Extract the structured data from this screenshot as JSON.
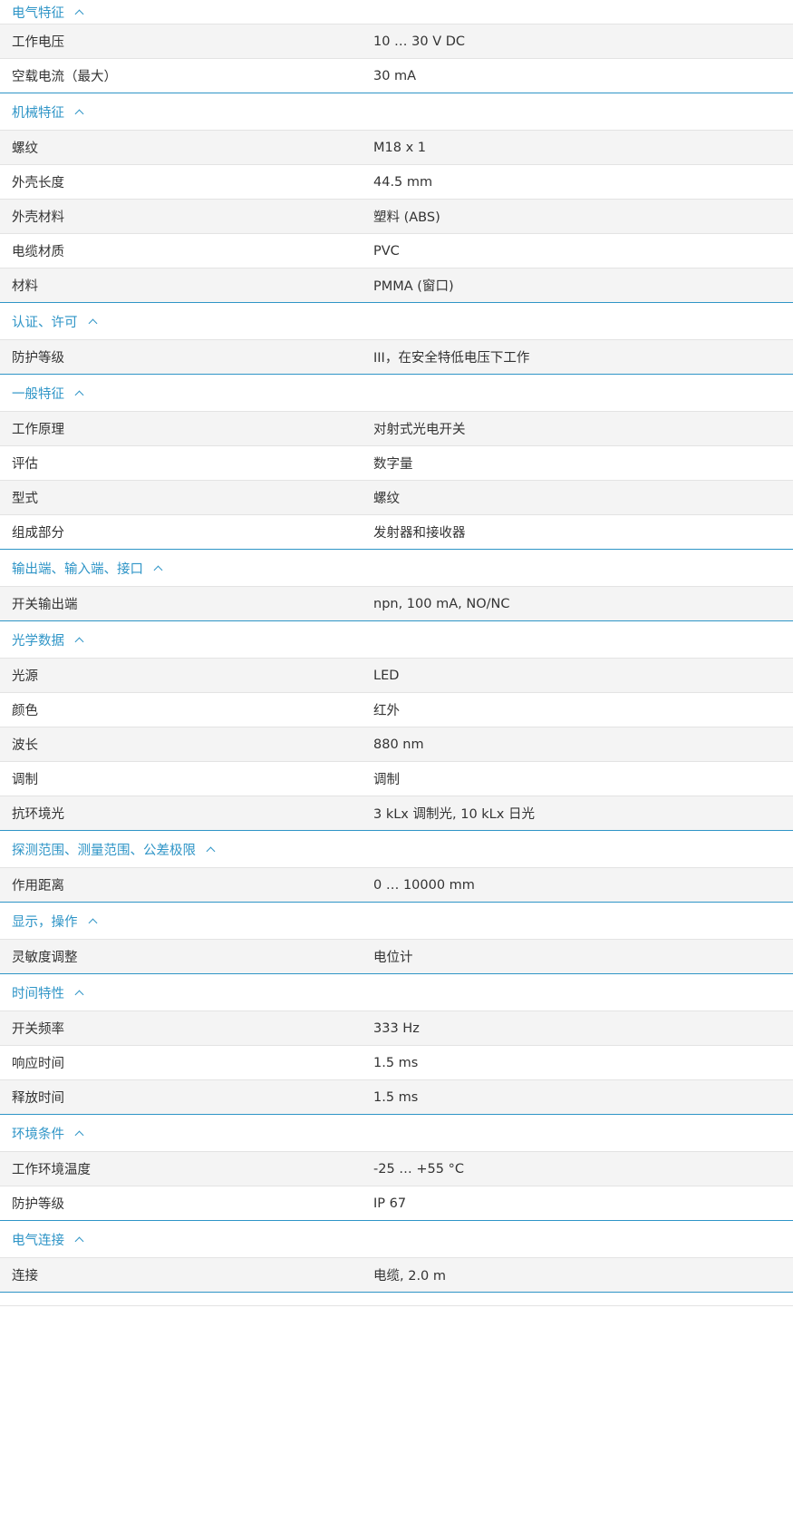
{
  "sections": [
    {
      "title": "电气特征",
      "rows": [
        {
          "label": "工作电压",
          "value": "10 … 30 V DC"
        },
        {
          "label": "空载电流（最大）",
          "value": "30 mA"
        }
      ]
    },
    {
      "title": "机械特征",
      "rows": [
        {
          "label": "螺纹",
          "value": "M18 x 1"
        },
        {
          "label": "外壳长度",
          "value": "44.5 mm"
        },
        {
          "label": "外壳材料",
          "value": "塑料 (ABS)"
        },
        {
          "label": "电缆材质",
          "value": "PVC"
        },
        {
          "label": "材料",
          "value": "PMMA (窗口)"
        }
      ]
    },
    {
      "title": "认证、许可",
      "rows": [
        {
          "label": "防护等级",
          "value": "III，在安全特低电压下工作"
        }
      ]
    },
    {
      "title": "一般特征",
      "rows": [
        {
          "label": "工作原理",
          "value": "对射式光电开关"
        },
        {
          "label": "评估",
          "value": "数字量"
        },
        {
          "label": "型式",
          "value": "螺纹"
        },
        {
          "label": "组成部分",
          "value": "发射器和接收器"
        }
      ]
    },
    {
      "title": "输出端、输入端、接口",
      "rows": [
        {
          "label": "开关输出端",
          "value": "npn, 100 mA, NO/NC"
        }
      ]
    },
    {
      "title": "光学数据",
      "rows": [
        {
          "label": "光源",
          "value": "LED"
        },
        {
          "label": "颜色",
          "value": "红外"
        },
        {
          "label": "波长",
          "value": "880 nm"
        },
        {
          "label": "调制",
          "value": "调制"
        },
        {
          "label": "抗环境光",
          "value": "3 kLx 调制光, 10 kLx 日光"
        }
      ]
    },
    {
      "title": "探测范围、测量范围、公差极限",
      "rows": [
        {
          "label": "作用距离",
          "value": "0 … 10000 mm"
        }
      ]
    },
    {
      "title": "显示，操作",
      "rows": [
        {
          "label": "灵敏度调整",
          "value": "电位计"
        }
      ]
    },
    {
      "title": "时间特性",
      "rows": [
        {
          "label": "开关频率",
          "value": "333 Hz"
        },
        {
          "label": "响应时间",
          "value": "1.5 ms"
        },
        {
          "label": "释放时间",
          "value": "1.5 ms"
        }
      ]
    },
    {
      "title": "环境条件",
      "rows": [
        {
          "label": "工作环境温度",
          "value": "-25 … +55 °C"
        },
        {
          "label": "防护等级",
          "value": "IP 67"
        }
      ]
    },
    {
      "title": "电气连接",
      "rows": [
        {
          "label": "连接",
          "value": "电缆, 2.0 m"
        }
      ]
    }
  ],
  "colors": {
    "accent": "#2f95c7",
    "row_alt": "#f4f4f4",
    "divider": "#e3e3e3"
  },
  "icons": {
    "section_toggle": "chevron-up-icon"
  }
}
